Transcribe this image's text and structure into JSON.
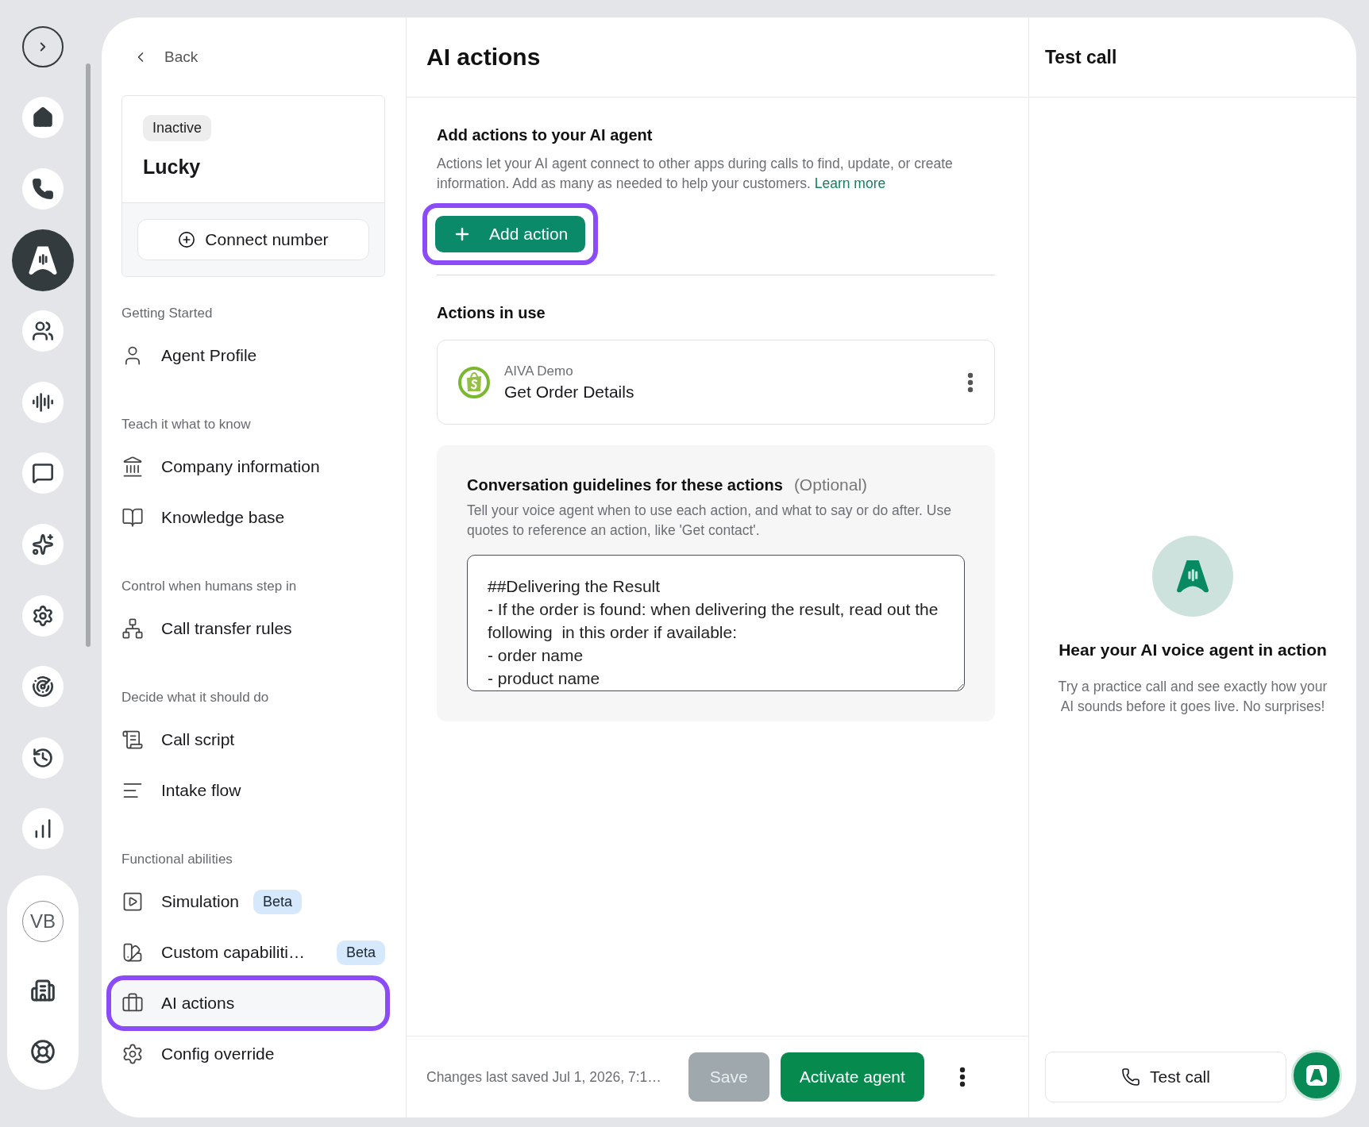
{
  "rail": {
    "toggle": {
      "expanded": false
    },
    "items": [
      {
        "selected": false
      },
      {
        "selected": false
      },
      {
        "selected": true
      },
      {
        "selected": false
      },
      {
        "selected": false
      },
      {
        "selected": false
      },
      {
        "selected": false
      },
      {
        "selected": false
      },
      {
        "selected": false
      },
      {
        "selected": false
      },
      {
        "selected": false
      }
    ],
    "account": {
      "avatar": "VB"
    },
    "bottom_items": [
      {
        "selected": false
      },
      {
        "selected": false
      }
    ]
  },
  "sidebar": {
    "back": "Back",
    "agent": {
      "status": "Inactive",
      "name": "Lucky",
      "connect_button": "Connect number"
    },
    "groups": [
      {
        "heading": "Getting Started",
        "items": [
          {
            "label": "Agent Profile",
            "selected": false,
            "highlighted": false
          }
        ]
      },
      {
        "heading": "Teach it what to know",
        "items": [
          {
            "label": "Company information",
            "selected": false,
            "highlighted": false
          },
          {
            "label": "Knowledge base",
            "selected": false,
            "highlighted": false
          }
        ]
      },
      {
        "heading": "Control when humans step in",
        "items": [
          {
            "label": "Call transfer rules",
            "selected": false,
            "highlighted": false
          }
        ]
      },
      {
        "heading": "Decide what it should do",
        "items": [
          {
            "label": "Call script",
            "selected": false,
            "highlighted": false
          },
          {
            "label": "Intake flow",
            "selected": false,
            "highlighted": false
          }
        ]
      },
      {
        "heading": "Functional abilities",
        "items": [
          {
            "label": "Simulation",
            "badge": "Beta",
            "selected": false,
            "highlighted": false
          },
          {
            "label": "Custom capabiliti…",
            "badge": "Beta",
            "selected": false,
            "highlighted": false
          },
          {
            "label": "AI actions",
            "selected": true,
            "highlighted": true
          },
          {
            "label": "Config override",
            "selected": false,
            "highlighted": false
          }
        ]
      }
    ]
  },
  "main": {
    "title": "AI actions",
    "add_section": {
      "heading": "Add actions to your AI agent",
      "description": "Actions let your AI agent connect to other apps during calls to find, update, or create information. Add as many as needed to help your customers.",
      "link": "Learn more",
      "button": {
        "label": "Add action",
        "highlighted": true
      }
    },
    "actions_in_use": {
      "heading": "Actions in use",
      "items": [
        {
          "app": "AIVA Demo",
          "name": "Get Order Details"
        }
      ]
    },
    "guidelines": {
      "heading": "Conversation guidelines for these actions",
      "optional": "(Optional)",
      "description": "Tell your voice agent when to use each action, and what to say or do after. Use quotes to reference an action, like 'Get contact'.",
      "value": "##Delivering the Result\n- If the order is found: when delivering the result, read out the following  in this order if available:\n- order name\n- product name"
    },
    "footer": {
      "saved_text": "Changes last saved Jul 1, 2026, 7:1…",
      "save": {
        "label": "Save",
        "disabled": true
      },
      "activate": "Activate agent"
    }
  },
  "test_panel": {
    "title": "Test call",
    "heading": "Hear your AI voice agent in action",
    "description": "Try a practice call and see exactly how your AI sounds before it goes live. No surprises!",
    "button": "Test call"
  }
}
